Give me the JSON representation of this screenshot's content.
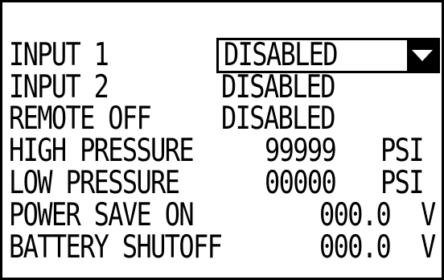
{
  "settings": {
    "input1": {
      "label": "INPUT 1",
      "value": "DISABLED"
    },
    "input2": {
      "label": "INPUT 2",
      "value": "DISABLED"
    },
    "remote_off": {
      "label": "REMOTE OFF",
      "value": "DISABLED"
    },
    "high_pressure": {
      "label": "HIGH PRESSURE",
      "value": "99999",
      "unit": "PSI"
    },
    "low_pressure": {
      "label": "LOW PRESSURE",
      "value": "00000",
      "unit": "PSI"
    },
    "power_save_on": {
      "label": "POWER SAVE ON",
      "value": "000.0",
      "unit": "V"
    },
    "battery_shutoff": {
      "label": "BATTERY SHUTOFF",
      "value": "000.0",
      "unit": "V"
    }
  },
  "icons": {
    "dropdown": "chevron-down-icon"
  },
  "colors": {
    "foreground": "#000000",
    "background": "#ffffff"
  }
}
